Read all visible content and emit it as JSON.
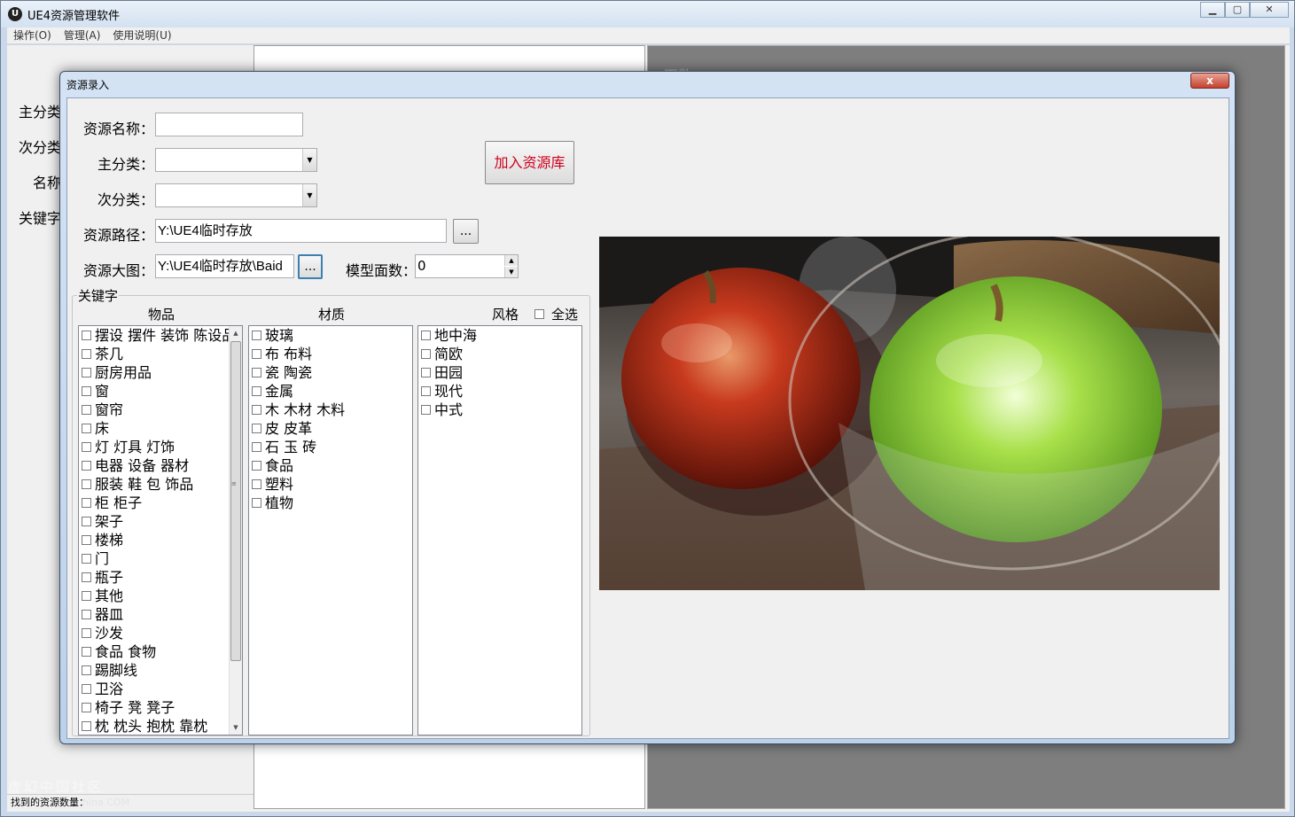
{
  "main": {
    "title": "UE4资源管理软件",
    "app_icon": "U",
    "menu": [
      "操作(O)",
      "管理(A)",
      "使用说明(U)"
    ],
    "left_labels": [
      "主分类",
      "次分类",
      "名称",
      "关键字"
    ],
    "gray_label": "面数：",
    "status": "找到的资源数量：",
    "watermark": "虚幻中国社区",
    "watermark_url": "hina.COM"
  },
  "dialog": {
    "title": "资源录入",
    "close_label": "x",
    "labels": {
      "name": "资源名称：",
      "main_cat": "主分类：",
      "sub_cat": "次分类：",
      "path": "资源路径：",
      "image": "资源大图：",
      "faces": "模型面数："
    },
    "values": {
      "name": "",
      "main_cat": "",
      "sub_cat": "",
      "path": "Y:\\UE4临时存放",
      "image": "Y:\\UE4临时存放\\Baid",
      "faces": "0"
    },
    "browse_label": "...",
    "add_button": "加入资源库",
    "keywords_group": "关键字",
    "columns": {
      "items": "物品",
      "material": "材质",
      "style": "风格"
    },
    "select_all": "全选",
    "items": [
      "摆设 摆件 装饰 陈设品",
      "茶几",
      "厨房用品",
      "窗",
      "窗帘",
      "床",
      "灯 灯具 灯饰",
      "电器 设备 器材",
      "服装 鞋 包 饰品",
      "柜 柜子",
      "架子",
      "楼梯",
      "门",
      "瓶子",
      "其他",
      "器皿",
      "沙发",
      "食品 食物",
      "踢脚线",
      "卫浴",
      "椅子 凳 凳子",
      "枕 枕头 抱枕 靠枕"
    ],
    "materials": [
      "玻璃",
      "布 布料",
      "瓷 陶瓷",
      "金属",
      "木 木材 木料",
      "皮 皮革",
      "石 玉 砖",
      "食品",
      "塑料",
      "植物"
    ],
    "styles": [
      "地中海",
      "简欧",
      "田园",
      "现代",
      "中式"
    ]
  }
}
